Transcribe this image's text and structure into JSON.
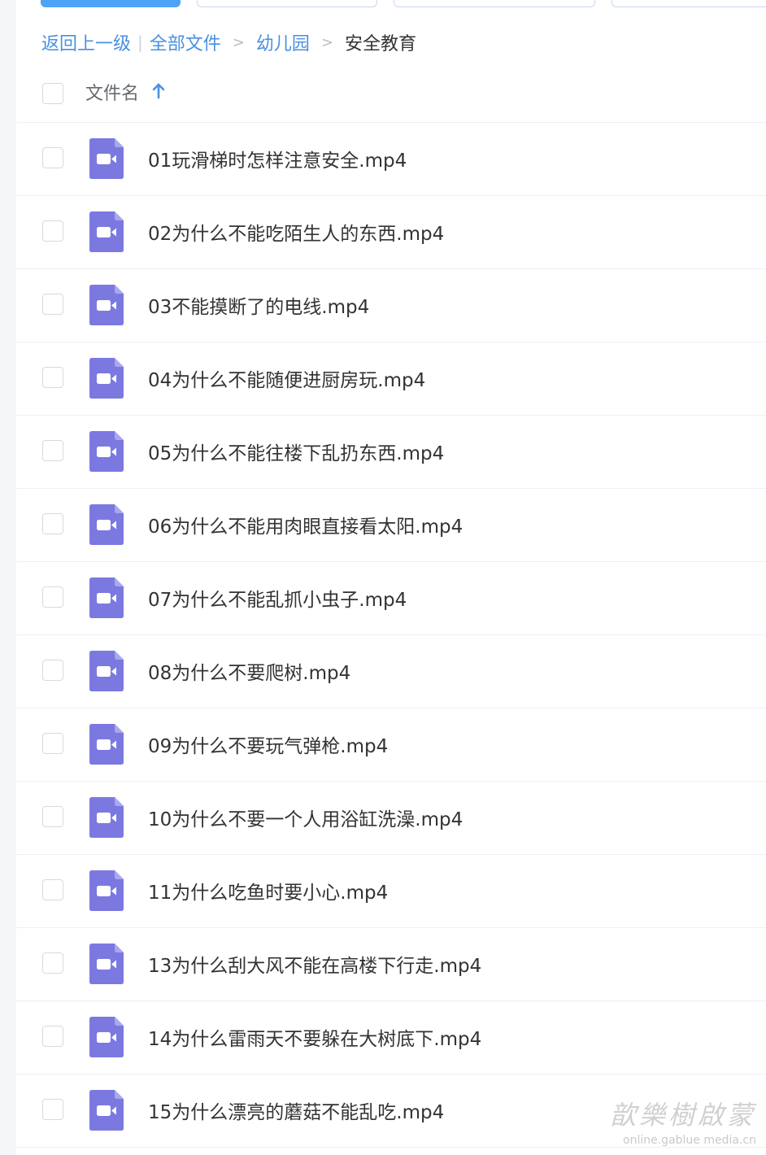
{
  "breadcrumb": {
    "back": "返回上一级",
    "all_files": "全部文件",
    "parent": "幼儿园",
    "current": "安全教育"
  },
  "header": {
    "name_label": "文件名"
  },
  "colors": {
    "accent": "#4a90e2",
    "video_icon": "#7b79e0"
  },
  "files": [
    {
      "name": "01玩滑梯时怎样注意安全.mp4"
    },
    {
      "name": "02为什么不能吃陌生人的东西.mp4"
    },
    {
      "name": "03不能摸断了的电线.mp4"
    },
    {
      "name": "04为什么不能随便进厨房玩.mp4"
    },
    {
      "name": "05为什么不能往楼下乱扔东西.mp4"
    },
    {
      "name": "06为什么不能用肉眼直接看太阳.mp4"
    },
    {
      "name": "07为什么不能乱抓小虫子.mp4"
    },
    {
      "name": "08为什么不要爬树.mp4"
    },
    {
      "name": "09为什么不要玩气弹枪.mp4"
    },
    {
      "name": "10为什么不要一个人用浴缸洗澡.mp4"
    },
    {
      "name": "11为什么吃鱼时要小心.mp4"
    },
    {
      "name": "13为什么刮大风不能在高楼下行走.mp4"
    },
    {
      "name": "14为什么雷雨天不要躲在大树底下.mp4"
    },
    {
      "name": "15为什么漂亮的蘑菇不能乱吃.mp4"
    }
  ],
  "watermark": {
    "main": "歆樂樹啟蒙",
    "sub": "online.gablue media.cn"
  }
}
